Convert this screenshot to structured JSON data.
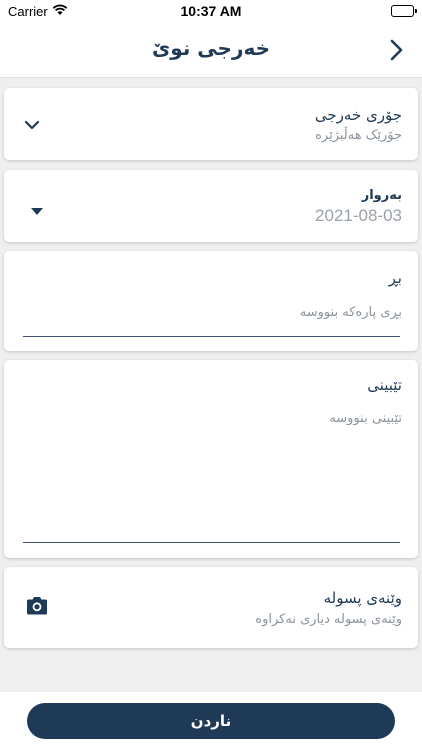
{
  "status_bar": {
    "carrier": "Carrier",
    "time": "10:37 AM"
  },
  "nav": {
    "title": "خەرجی نوێ",
    "back_icon": "chevron-right-icon"
  },
  "form": {
    "expense_type": {
      "label": "جۆری خەرجی",
      "placeholder": "جۆرێک هەڵبژێرە",
      "icon": "chevron-down-icon"
    },
    "date": {
      "label": "بەروار",
      "value": "2021-08-03",
      "icon": "triangle-down-icon"
    },
    "amount": {
      "label": "بڕ",
      "placeholder": "بڕی پارەکە بنووسە"
    },
    "note": {
      "label": "تێبینی",
      "placeholder": "تێبینی بنووسە"
    },
    "receipt": {
      "label": "وێنەی پسولە",
      "placeholder": "وێنەی پسولە دیاری نەکراوە",
      "icon": "camera-icon"
    }
  },
  "submit_label": "ناردن",
  "colors": {
    "primary": "#1f3a57",
    "background": "#efefef",
    "muted": "#8b939b"
  }
}
